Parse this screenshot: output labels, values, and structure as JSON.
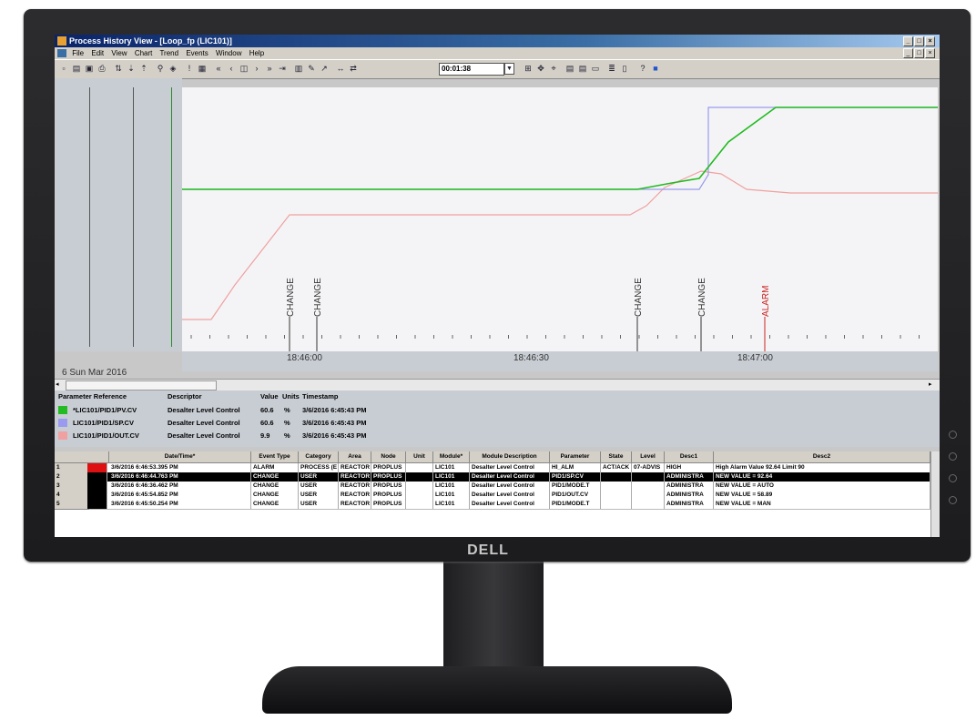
{
  "window": {
    "title": "Process History View - [Loop_fp (LIC101)]"
  },
  "brand": "DELL",
  "menu": [
    "File",
    "Edit",
    "View",
    "Chart",
    "Trend",
    "Events",
    "Window",
    "Help"
  ],
  "toolbar": {
    "time_value": "00:01:38"
  },
  "chart_data": {
    "type": "line",
    "x_ticks": [
      "18:46:00",
      "18:46:30",
      "18:47:00"
    ],
    "date_label": "6 Sun Mar 2016",
    "events": [
      {
        "label": "CHANGE",
        "color": "#333333"
      },
      {
        "label": "CHANGE",
        "color": "#333333"
      },
      {
        "label": "CHANGE",
        "color": "#333333"
      },
      {
        "label": "CHANGE",
        "color": "#333333"
      },
      {
        "label": "ALARM",
        "color": "#cc2222"
      }
    ],
    "series": [
      {
        "name": "LIC101/PID1/PV.CV",
        "color": "#22bb22"
      },
      {
        "name": "LIC101/PID1/SP.CV",
        "color": "#9a9aee"
      },
      {
        "name": "LIC101/PID1/OUT.CV",
        "color": "#f0a0a0"
      }
    ]
  },
  "legend": {
    "headers": [
      "Parameter Reference",
      "Descriptor",
      "Value",
      "Units",
      "Timestamp"
    ],
    "rows": [
      {
        "ref": "*LIC101/PID1/PV.CV",
        "desc": "Desalter Level Control",
        "value": "60.6",
        "units": "%",
        "ts": "3/6/2016 6:45:43 PM",
        "color": "#22bb22"
      },
      {
        "ref": "LIC101/PID1/SP.CV",
        "desc": "Desalter Level Control",
        "value": "60.6",
        "units": "%",
        "ts": "3/6/2016 6:45:43 PM",
        "color": "#9a9aee"
      },
      {
        "ref": "LIC101/PID1/OUT.CV",
        "desc": "Desalter Level Control",
        "value": "9.9",
        "units": "%",
        "ts": "3/6/2016 6:45:43 PM",
        "color": "#f0a0a0"
      }
    ]
  },
  "events": {
    "headers": [
      "Date/Time*",
      "Event Type",
      "Category",
      "Area",
      "Node",
      "Unit",
      "Module*",
      "Module Description",
      "Parameter",
      "State",
      "Level",
      "Desc1",
      "Desc2"
    ],
    "rows": [
      {
        "n": "1",
        "flag": "#dd1111",
        "dt": "3/6/2016 6:46:53.395 PM",
        "type": "ALARM",
        "cat": "PROCESS (E",
        "area": "REACTOR",
        "node": "PROPLUS",
        "unit": "",
        "module": "LIC101",
        "mdesc": "Desalter Level Control",
        "param": "HI_ALM",
        "state": "ACT/ACK",
        "level": "07-ADVIS",
        "d1": "HIGH",
        "d2": "High Alarm Value 92.64 Limit 90"
      },
      {
        "n": "2",
        "flag": "#000000",
        "dt": "3/6/2016 6:46:44.763 PM",
        "type": "CHANGE",
        "cat": "USER",
        "area": "REACTOR",
        "node": "PROPLUS",
        "unit": "",
        "module": "LIC101",
        "mdesc": "Desalter Level Control",
        "param": "PID1/SP.CV",
        "state": "",
        "level": "",
        "d1": "ADMINISTRA",
        "d2": "NEW VALUE = 92.64"
      },
      {
        "n": "3",
        "flag": "#000000",
        "dt": "3/6/2016 6:46:36.462 PM",
        "type": "CHANGE",
        "cat": "USER",
        "area": "REACTOR",
        "node": "PROPLUS",
        "unit": "",
        "module": "LIC101",
        "mdesc": "Desalter Level Control",
        "param": "PID1/MODE.T",
        "state": "",
        "level": "",
        "d1": "ADMINISTRA",
        "d2": "NEW VALUE = AUTO"
      },
      {
        "n": "4",
        "flag": "#000000",
        "dt": "3/6/2016 6:45:54.852 PM",
        "type": "CHANGE",
        "cat": "USER",
        "area": "REACTOR",
        "node": "PROPLUS",
        "unit": "",
        "module": "LIC101",
        "mdesc": "Desalter Level Control",
        "param": "PID1/OUT.CV",
        "state": "",
        "level": "",
        "d1": "ADMINISTRA",
        "d2": "NEW VALUE = 58.89"
      },
      {
        "n": "5",
        "flag": "#000000",
        "dt": "3/6/2016 6:45:50.254 PM",
        "type": "CHANGE",
        "cat": "USER",
        "area": "REACTOR",
        "node": "PROPLUS",
        "unit": "",
        "module": "LIC101",
        "mdesc": "Desalter Level Control",
        "param": "PID1/MODE.T",
        "state": "",
        "level": "",
        "d1": "ADMINISTRA",
        "d2": "NEW VALUE = MAN"
      }
    ]
  }
}
